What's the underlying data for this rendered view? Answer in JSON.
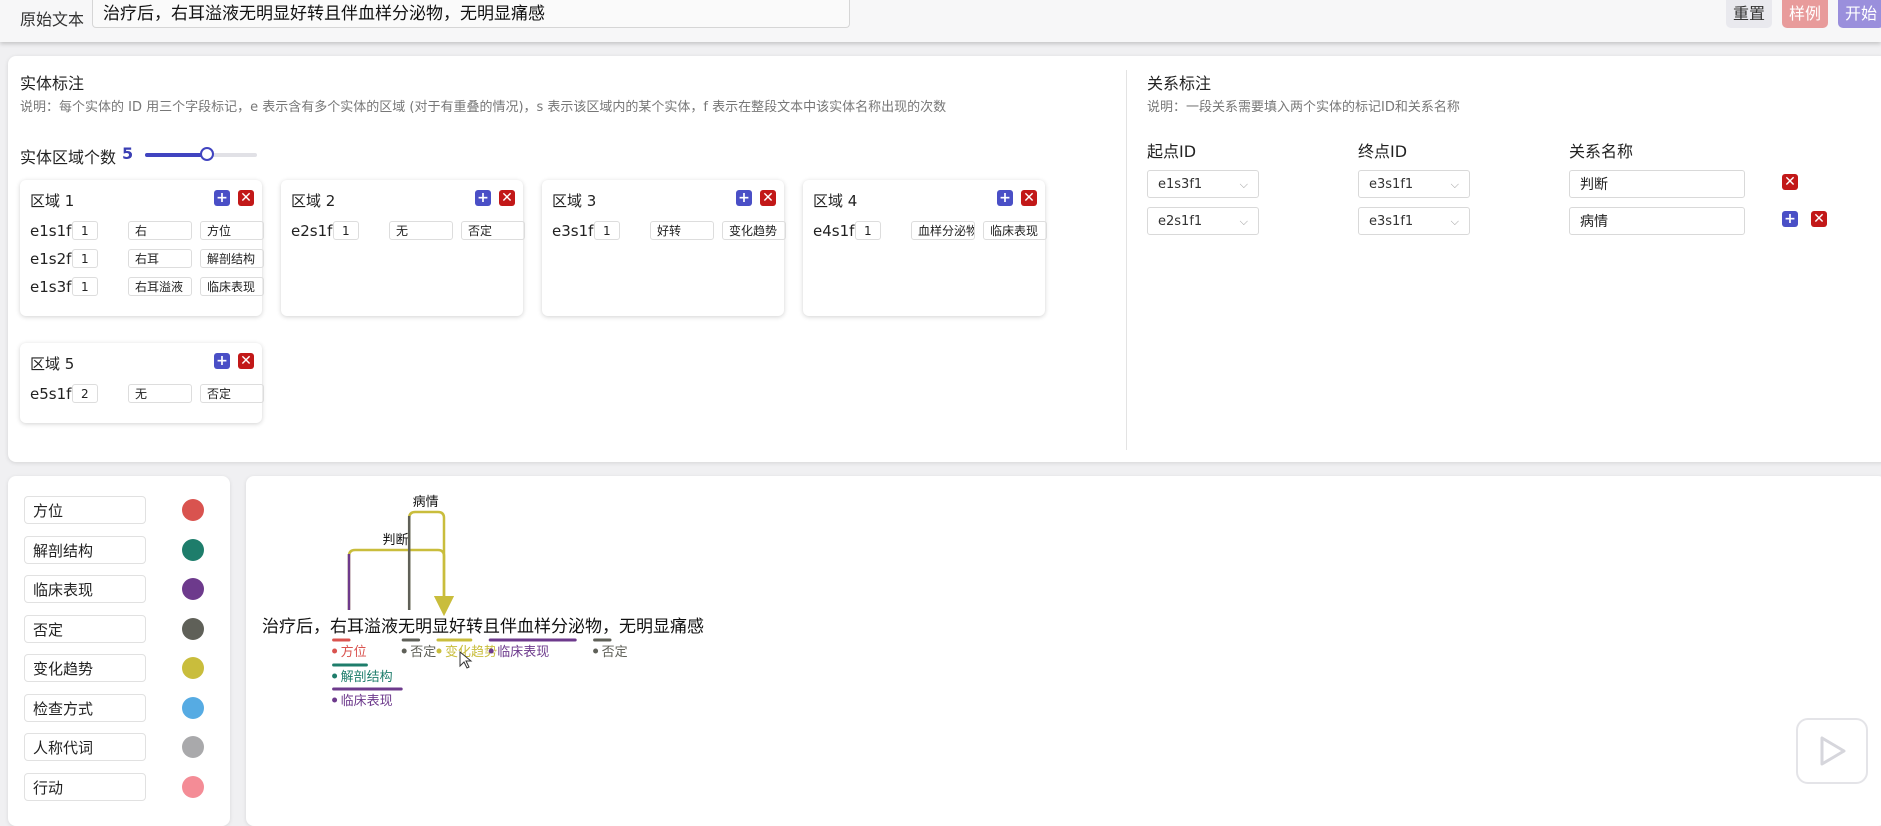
{
  "top_bar": {
    "original_label": "原始文本",
    "original_text": "治疗后，右耳溢液无明显好转且伴血样分泌物，无明显痛感",
    "reset_label": "重置",
    "sample_label": "样例",
    "start_label": "开始"
  },
  "entity_section": {
    "title": "实体标注",
    "description": "说明：每个实体的 ID 用三个字段标记，e 表示含有多个实体的区域 (对于有重叠的情况)，s 表示该区域内的某个实体，f 表示在整段文本中该实体名称出现的次数",
    "count_label": "实体区域个数",
    "count_value": "5",
    "slider_fraction": 0.55,
    "regions": [
      {
        "title": "区域 1",
        "entities": [
          {
            "id": "e1s1f",
            "f": "1",
            "name": "右",
            "type": "方位"
          },
          {
            "id": "e1s2f",
            "f": "1",
            "name": "右耳",
            "type": "解剖结构"
          },
          {
            "id": "e1s3f",
            "f": "1",
            "name": "右耳溢液",
            "type": "临床表现"
          }
        ]
      },
      {
        "title": "区域 2",
        "entities": [
          {
            "id": "e2s1f",
            "f": "1",
            "name": "无",
            "type": "否定"
          }
        ]
      },
      {
        "title": "区域 3",
        "entities": [
          {
            "id": "e3s1f",
            "f": "1",
            "name": "好转",
            "type": "变化趋势"
          }
        ]
      },
      {
        "title": "区域 4",
        "entities": [
          {
            "id": "e4s1f",
            "f": "1",
            "name": "血样分泌物",
            "type": "临床表现"
          }
        ]
      },
      {
        "title": "区域 5",
        "entities": [
          {
            "id": "e5s1f",
            "f": "2",
            "name": "无",
            "type": "否定"
          }
        ]
      }
    ]
  },
  "relation_section": {
    "title": "关系标注",
    "description": "说明：一段关系需要填入两个实体的标记ID和关系名称",
    "headers": {
      "start": "起点ID",
      "end": "终点ID",
      "name": "关系名称"
    },
    "relations": [
      {
        "start": "e1s3f1",
        "end": "e3s1f1",
        "name": "判断"
      },
      {
        "start": "e2s1f1",
        "end": "e3s1f1",
        "name": "病情"
      }
    ]
  },
  "legend": {
    "items": [
      {
        "label": "方位",
        "color": "#d9534f"
      },
      {
        "label": "解剖结构",
        "color": "#1e7d6b"
      },
      {
        "label": "临床表现",
        "color": "#6d3a8c"
      },
      {
        "label": "否定",
        "color": "#5f6058"
      },
      {
        "label": "变化趋势",
        "color": "#c9bd3c"
      },
      {
        "label": "检查方式",
        "color": "#56abe3"
      },
      {
        "label": "人称代词",
        "color": "#a9a9ab"
      },
      {
        "label": "行动",
        "color": "#f48c96"
      }
    ]
  },
  "visualization": {
    "text": "治疗后，右耳溢液无明显好转且伴血样分泌物，无明显痛感",
    "relation_labels": [
      "病情",
      "判断"
    ],
    "entity_labels": [
      {
        "label": "方位",
        "color": "#d9534f"
      },
      {
        "label": "否定",
        "color": "#5f6058"
      },
      {
        "label": "变化趋势",
        "color": "#c9bd3c"
      },
      {
        "label": "临床表现",
        "color": "#6d3a8c"
      },
      {
        "label": "否定",
        "color": "#5f6058"
      },
      {
        "label": "解剖结构",
        "color": "#1e7d6b"
      },
      {
        "label": "临床表现",
        "color": "#6d3a8c"
      }
    ]
  }
}
